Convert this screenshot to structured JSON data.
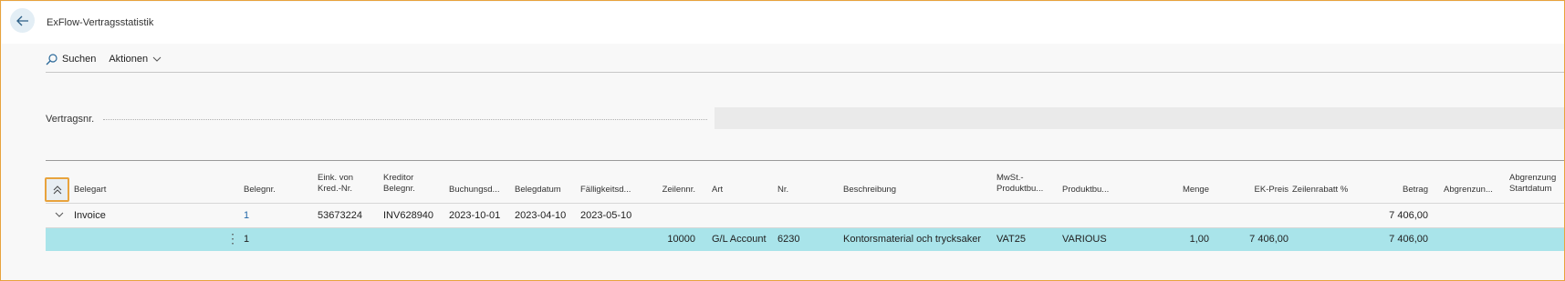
{
  "header": {
    "title": "ExFlow-Vertragsstatistik"
  },
  "actions": {
    "search_label": "Suchen",
    "actions_label": "Aktionen"
  },
  "form": {
    "contract_no_label": "Vertragsnr.",
    "contract_no_value": ""
  },
  "grid": {
    "columns": [
      {
        "l1": "",
        "l2": "Belegart"
      },
      {
        "l1": "",
        "l2": "Belegnr."
      },
      {
        "l1": "Eink. von",
        "l2": "Kred.-Nr."
      },
      {
        "l1": "Kreditor",
        "l2": "Belegnr."
      },
      {
        "l1": "",
        "l2": "Buchungsd..."
      },
      {
        "l1": "",
        "l2": "Belegdatum"
      },
      {
        "l1": "",
        "l2": "Fälligkeitsd..."
      },
      {
        "l1": "",
        "l2": "Zeilennr."
      },
      {
        "l1": "",
        "l2": "Art"
      },
      {
        "l1": "",
        "l2": "Nr."
      },
      {
        "l1": "",
        "l2": "Beschreibung"
      },
      {
        "l1": "MwSt.-",
        "l2": "Produktbu..."
      },
      {
        "l1": "",
        "l2": "Produktbu..."
      },
      {
        "l1": "",
        "l2": "Menge"
      },
      {
        "l1": "",
        "l2": "EK-Preis"
      },
      {
        "l1": "",
        "l2": "Zeilenrabatt %"
      },
      {
        "l1": "",
        "l2": "Betrag"
      },
      {
        "l1": "",
        "l2": "Abgrenzun..."
      },
      {
        "l1": "Abgrenzung",
        "l2": "Startdatum"
      }
    ],
    "group_row": {
      "belegart": "Invoice",
      "belegnr": "1",
      "kred_nr": "53673224",
      "kreditor_belegnr": "INV628940",
      "buchungsdatum": "2023-10-01",
      "belegdatum": "2023-04-10",
      "faelligkeitsdatum": "2023-05-10",
      "betrag": "7 406,00"
    },
    "line_row": {
      "belegnr": "1",
      "zeilennr": "10000",
      "art": "G/L Account",
      "nr": "6230",
      "beschreibung": "Kontorsmaterial och trycksaker",
      "mwst_produktbu": "VAT25",
      "produktbu": "VARIOUS",
      "menge": "1,00",
      "ek_preis": "7 406,00",
      "betrag": "7 406,00"
    }
  },
  "icons": {
    "back": "arrow-left-icon",
    "search": "search-icon",
    "dropdown": "chevron-down-icon",
    "collapse": "double-chevron-up-icon",
    "expander": "chevron-down-icon",
    "kebab": "more-vertical-icon"
  },
  "colors": {
    "accent_highlight": "#e8a33d",
    "link": "#2167a8",
    "selected_row": "#a9e4ea"
  }
}
